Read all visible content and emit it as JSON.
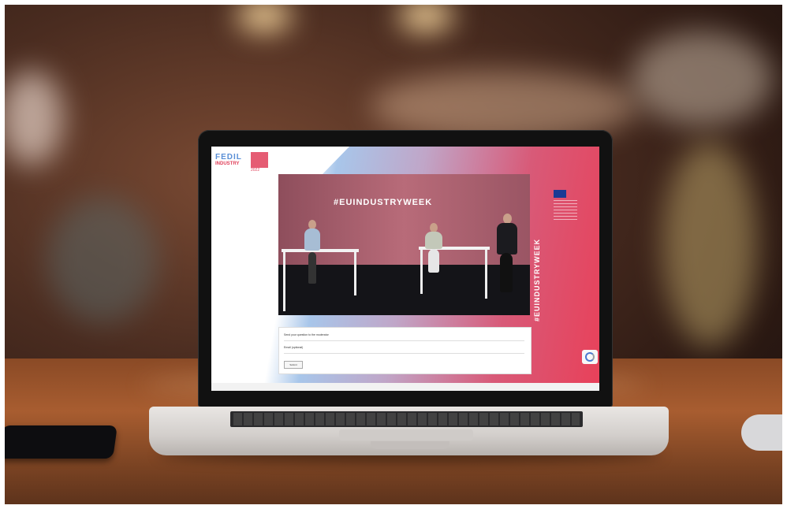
{
  "screen": {
    "logo": {
      "brand": "FEDIL",
      "sub": "INDUSTRY",
      "year": "2022"
    },
    "video": {
      "hashtag": "#EUINDUSTRYWEEK"
    },
    "side_banner": "#EUINDUSTRYWEEK",
    "form": {
      "question_label": "Send your question to the moderator",
      "email_label": "Email (optional)",
      "submit_label": "Submit"
    }
  },
  "colors": {
    "brand_blue": "#5a8fd6",
    "brand_red": "#e8415a",
    "eu_blue": "#1a3a94"
  },
  "icons": [
    "recaptcha-icon",
    "eu-flag-icon"
  ]
}
